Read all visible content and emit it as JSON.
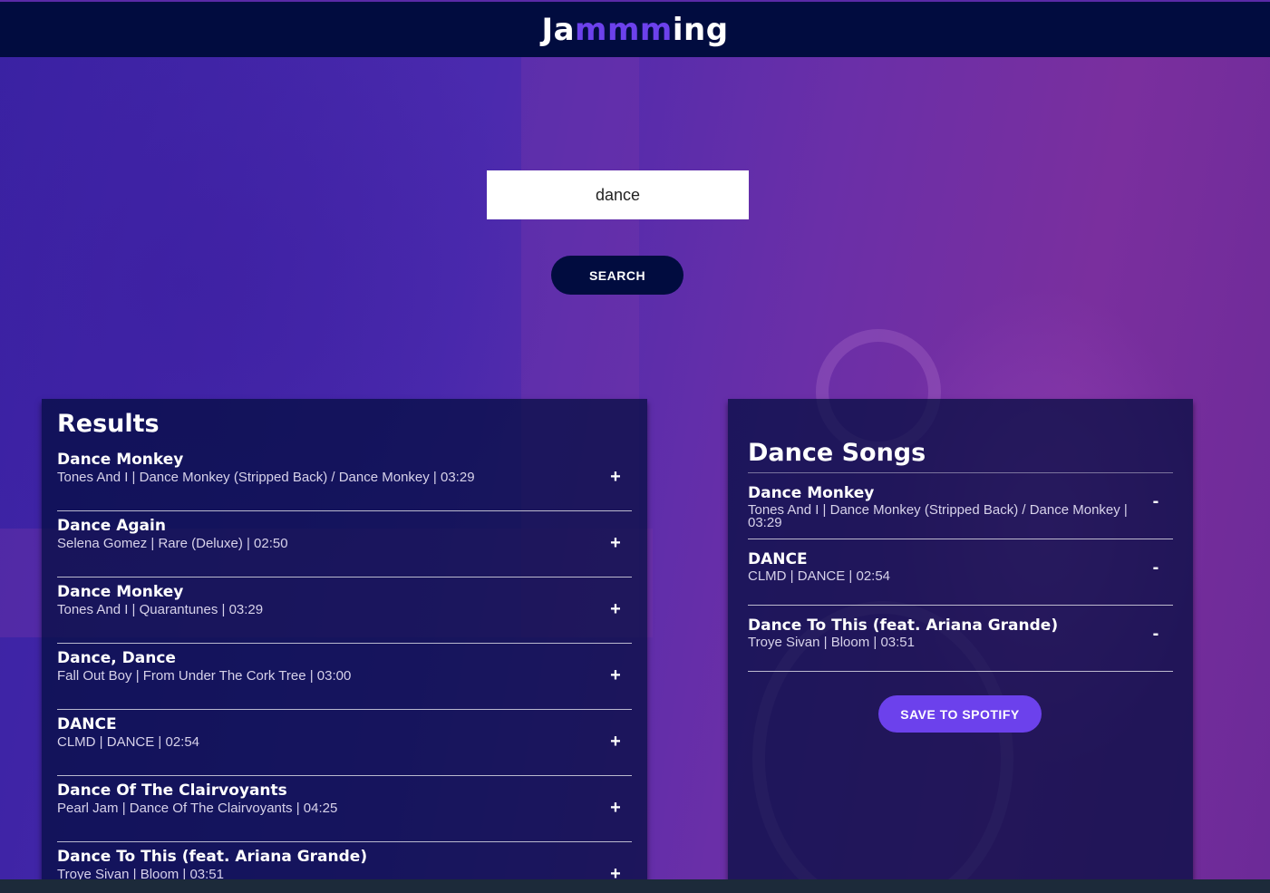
{
  "header": {
    "brand_start": "Ja",
    "brand_mid": "mmm",
    "brand_end": "ing"
  },
  "colors": {
    "header_bg": "#010c3f",
    "accent": "#6c41ec",
    "panel_bg": "rgba(1,12,63,0.72)"
  },
  "search": {
    "value": "dance",
    "button_label": "SEARCH"
  },
  "results": {
    "title": "Results",
    "action_symbol": "+",
    "tracks": [
      {
        "name": "Dance Monkey",
        "info": "Tones And I | Dance Monkey (Stripped Back) / Dance Monkey | 03:29"
      },
      {
        "name": "Dance Again",
        "info": "Selena Gomez | Rare (Deluxe) | 02:50"
      },
      {
        "name": "Dance Monkey",
        "info": "Tones And I | Quarantunes | 03:29"
      },
      {
        "name": "Dance, Dance",
        "info": "Fall Out Boy | From Under The Cork Tree | 03:00"
      },
      {
        "name": "DANCE",
        "info": "CLMD | DANCE | 02:54"
      },
      {
        "name": "Dance Of The Clairvoyants",
        "info": "Pearl Jam | Dance Of The Clairvoyants | 04:25"
      },
      {
        "name": "Dance To This (feat. Ariana Grande)",
        "info": "Troye Sivan | Bloom | 03:51"
      }
    ]
  },
  "playlist": {
    "name": "Dance Songs",
    "action_symbol": "-",
    "save_label": "SAVE TO SPOTIFY",
    "tracks": [
      {
        "name": "Dance Monkey",
        "info": "Tones And I | Dance Monkey (Stripped Back) / Dance Monkey | 03:29"
      },
      {
        "name": "DANCE",
        "info": "CLMD | DANCE | 02:54"
      },
      {
        "name": "Dance To This (feat. Ariana Grande)",
        "info": "Troye Sivan | Bloom | 03:51"
      }
    ]
  }
}
